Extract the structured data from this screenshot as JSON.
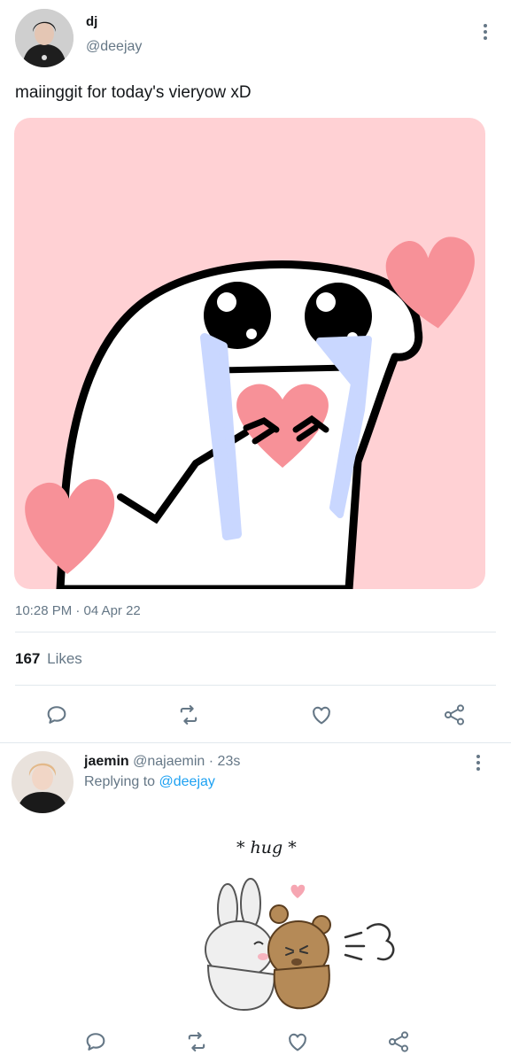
{
  "tweet": {
    "author_name": "dj",
    "author_handle": "@deejay",
    "text": "maiinggit for today's vieryow xD",
    "timestamp": "10:28 PM · 04 Apr 22",
    "likes_count": "167",
    "likes_label": "Likes",
    "actions": [
      "reply-icon",
      "retweet-icon",
      "like-icon",
      "share-icon"
    ]
  },
  "reply": {
    "author_name": "jaemin",
    "author_handle": "@najaemin",
    "time_ago": "· 23s",
    "replying_to_label": "Replying to",
    "replying_to_handle": "@deejay",
    "image_caption": "* hug *"
  },
  "colors": {
    "link": "#1da1f2",
    "muted": "#657786",
    "divider": "#e1e8ed",
    "image_bg": "#ffd1d4",
    "heart": "#f79198"
  }
}
